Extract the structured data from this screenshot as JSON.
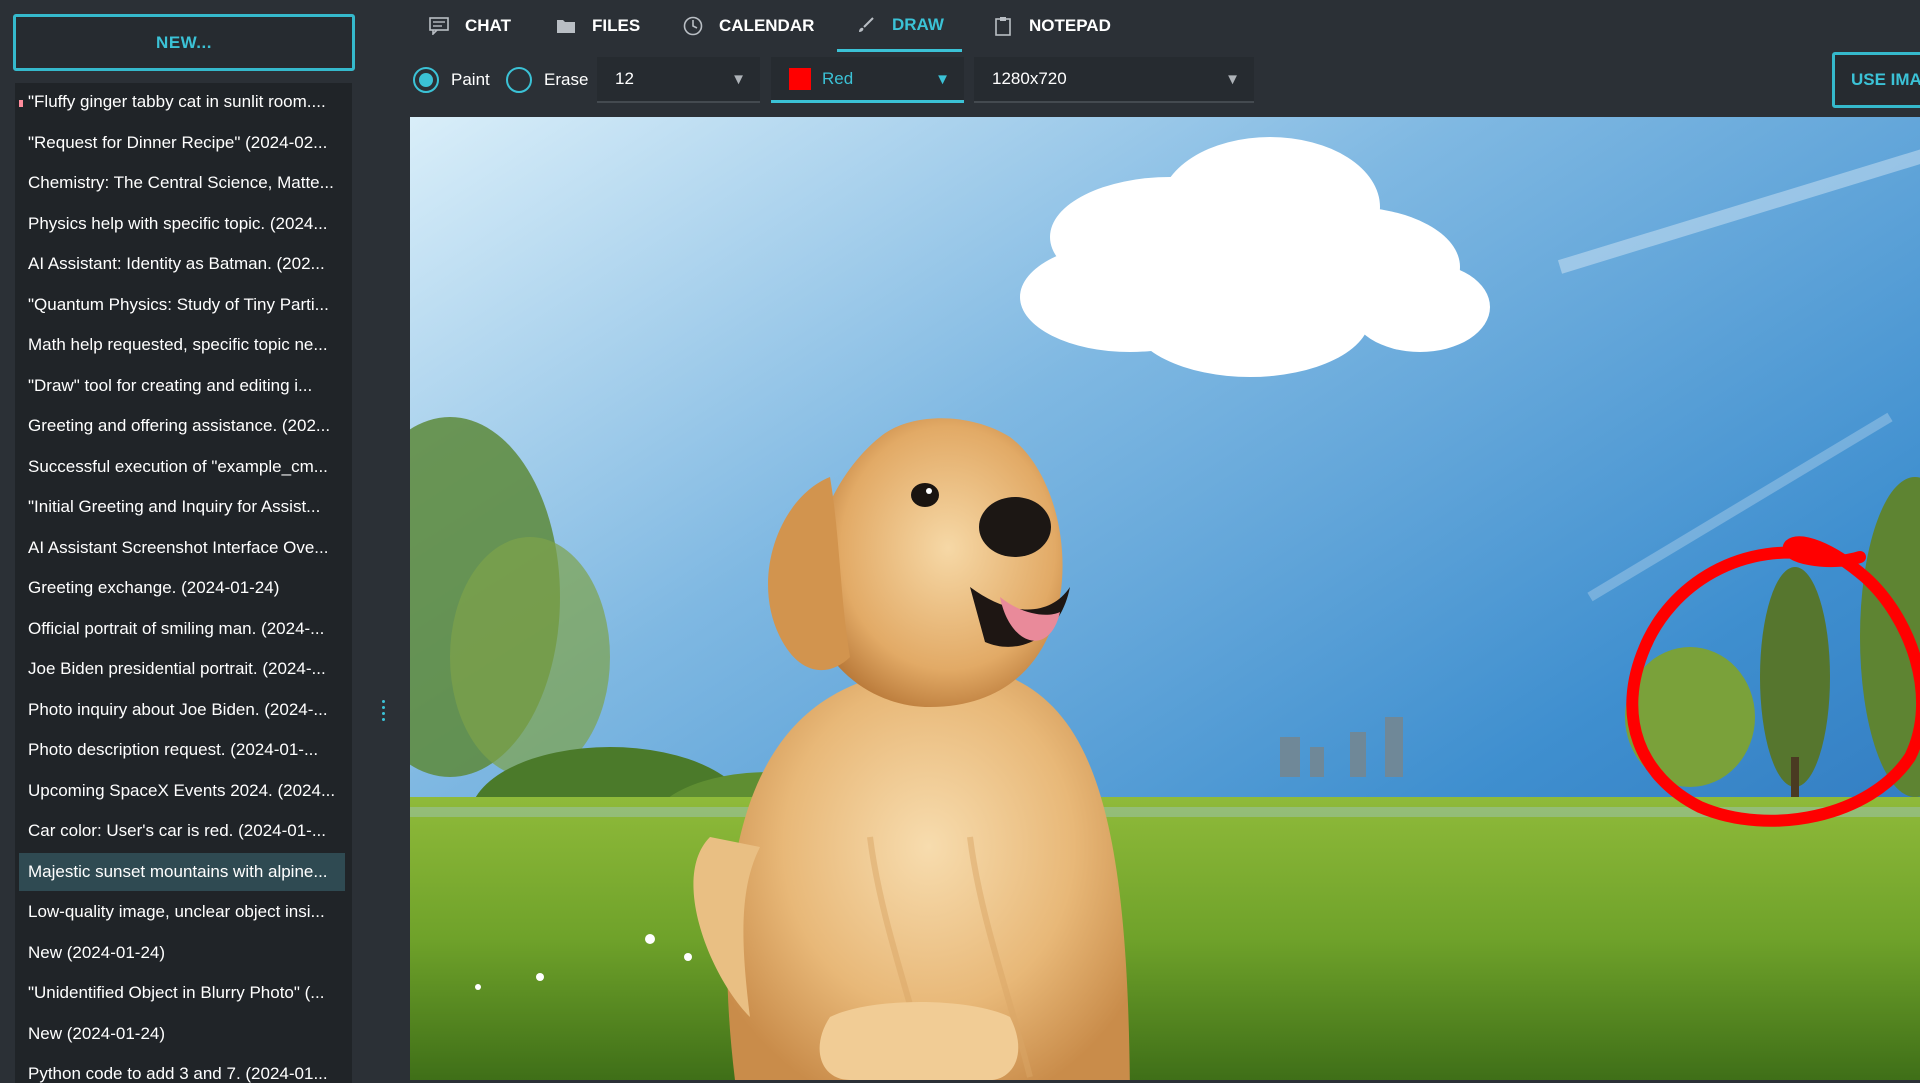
{
  "sidebar": {
    "new_button": "NEW...",
    "history": [
      "\"Fluffy ginger tabby cat in sunlit room....",
      "\"Request for Dinner Recipe\" (2024-02...",
      "Chemistry: The Central Science, Matte...",
      "Physics help with specific topic. (2024...",
      "AI Assistant: Identity as Batman. (202...",
      "\"Quantum Physics: Study of Tiny Parti...",
      "Math help requested, specific topic ne...",
      "\"Draw\" tool for creating and editing i...",
      "Greeting and offering assistance. (202...",
      "Successful execution of \"example_cm...",
      "\"Initial Greeting and Inquiry for Assist...",
      "AI Assistant Screenshot Interface Ove...",
      "Greeting exchange. (2024-01-24)",
      "Official portrait of smiling man. (2024-...",
      "Joe Biden presidential portrait. (2024-...",
      "Photo inquiry about Joe Biden. (2024-...",
      "Photo description request. (2024-01-...",
      "Upcoming SpaceX Events 2024. (2024...",
      "Car color: User's car is red. (2024-01-...",
      "Majestic sunset mountains with alpine...",
      "Low-quality image, unclear object insi...",
      "New (2024-01-24)",
      "\"Unidentified Object in Blurry Photo\" (...",
      "New (2024-01-24)",
      "Python code to add 3 and 7. (2024-01..."
    ],
    "selected_index": 19
  },
  "tabs": [
    {
      "label": "CHAT",
      "icon": "chat-icon"
    },
    {
      "label": "FILES",
      "icon": "folder-icon"
    },
    {
      "label": "CALENDAR",
      "icon": "clock-icon"
    },
    {
      "label": "DRAW",
      "icon": "brush-icon",
      "active": true
    },
    {
      "label": "NOTEPAD",
      "icon": "clipboard-icon"
    }
  ],
  "toolbar": {
    "mode_paint": "Paint",
    "mode_erase": "Erase",
    "selected_mode": "Paint",
    "brush_size": "12",
    "color_label": "Red",
    "color_value": "#ff0000",
    "resolution": "1280x720"
  },
  "use_image_button": "USE IMAGE",
  "colors": {
    "accent": "#3bc2d6",
    "background": "#2b3036",
    "panel": "#202428",
    "stroke": "#ff0000"
  },
  "canvas": {
    "image_subject": "golden-retriever-puppy-in-park",
    "annotation": "red-freehand-circle-around-trees"
  }
}
